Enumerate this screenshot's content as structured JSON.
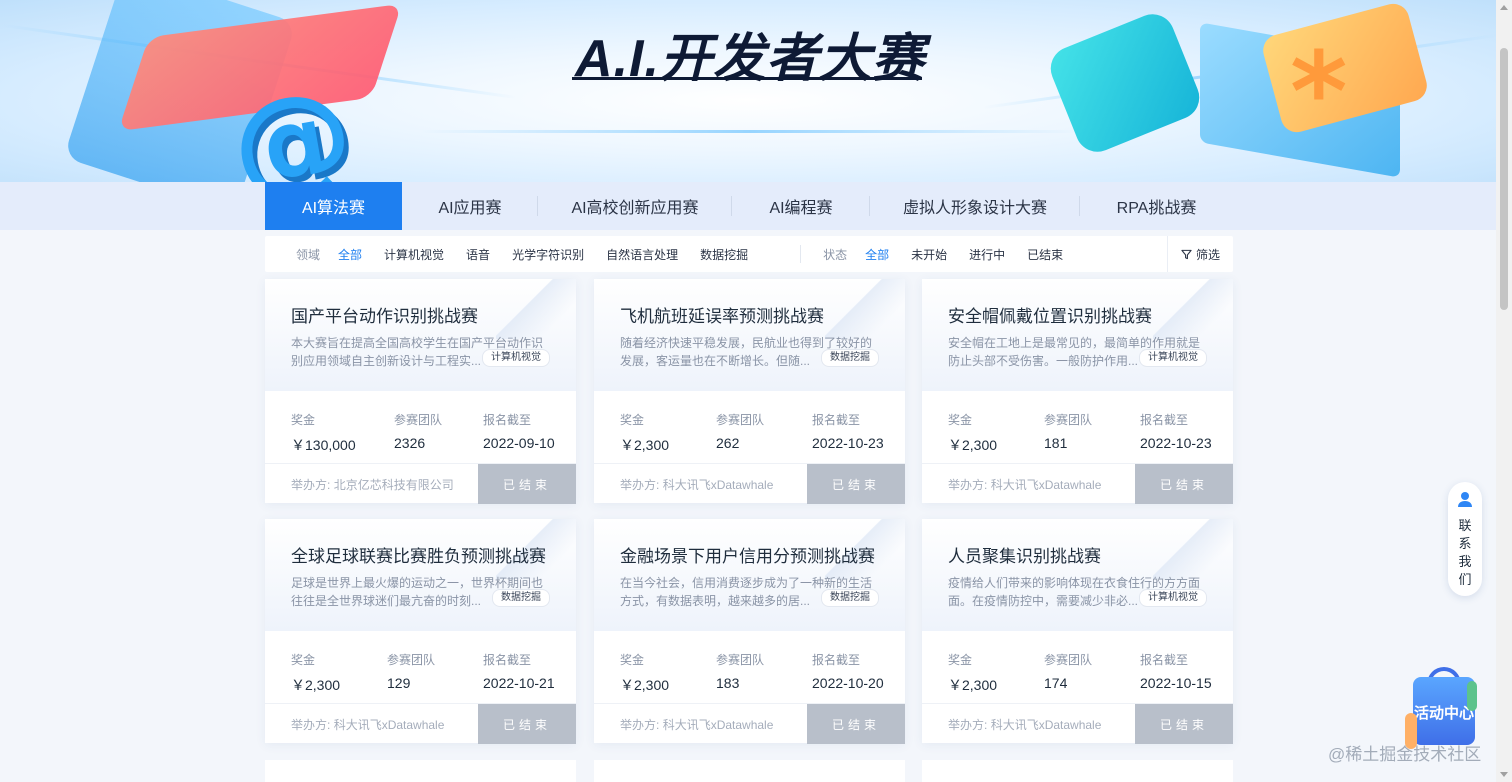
{
  "banner": {
    "logo": "A.I.开发者大赛"
  },
  "tabs": [
    {
      "label": "AI算法赛",
      "active": true
    },
    {
      "label": "AI应用赛"
    },
    {
      "label": "AI高校创新应用赛"
    },
    {
      "label": "AI编程赛"
    },
    {
      "label": "虚拟人形象设计大赛"
    },
    {
      "label": "RPA挑战赛"
    }
  ],
  "filter": {
    "domain_label": "领域",
    "domain_options": [
      "全部",
      "计算机视觉",
      "语音",
      "光学字符识别",
      "自然语言处理",
      "数据挖掘"
    ],
    "status_label": "状态",
    "status_options": [
      "全部",
      "未开始",
      "进行中",
      "已结束"
    ],
    "filter_button": "筛选"
  },
  "card_labels": {
    "prize": "奖金",
    "teams": "参赛团队",
    "deadline": "报名截至",
    "organizer_prefix": "举办方:"
  },
  "cards": [
    {
      "title": "国产平台动作识别挑战赛",
      "desc": "本大赛旨在提高全国高校学生在国产平台动作识别应用领域自主创新设计与工程实...",
      "tag": "计算机视觉",
      "prize": "￥130,000",
      "teams": "2326",
      "deadline": "2022-09-10",
      "organizer": "北京亿芯科技有限公司",
      "status": "已结束"
    },
    {
      "title": "飞机航班延误率预测挑战赛",
      "desc": "随着经济快速平稳发展，民航业也得到了较好的发展，客运量也在不断增长。但随...",
      "tag": "数据挖掘",
      "prize": "￥2,300",
      "teams": "262",
      "deadline": "2022-10-23",
      "organizer": "科大讯飞xDatawhale",
      "status": "已结束"
    },
    {
      "title": "安全帽佩戴位置识别挑战赛",
      "desc": "安全帽在工地上是最常见的，最简单的作用就是防止头部不受伤害。一般防护作用...",
      "tag": "计算机视觉",
      "prize": "￥2,300",
      "teams": "181",
      "deadline": "2022-10-23",
      "organizer": "科大讯飞xDatawhale",
      "status": "已结束"
    },
    {
      "title": "全球足球联赛比赛胜负预测挑战赛",
      "desc": "足球是世界上最火爆的运动之一，世界杯期间也往往是全世界球迷们最亢奋的时刻...",
      "tag": "数据挖掘",
      "prize": "￥2,300",
      "teams": "129",
      "deadline": "2022-10-21",
      "organizer": "科大讯飞xDatawhale",
      "status": "已结束"
    },
    {
      "title": "金融场景下用户信用分预测挑战赛",
      "desc": "在当今社会，信用消费逐步成为了一种新的生活方式，有数据表明，越来越多的居...",
      "tag": "数据挖掘",
      "prize": "￥2,300",
      "teams": "183",
      "deadline": "2022-10-20",
      "organizer": "科大讯飞xDatawhale",
      "status": "已结束"
    },
    {
      "title": "人员聚集识别挑战赛",
      "desc": "疫情给人们带来的影响体现在衣食住行的方方面面。在疫情防控中，需要减少非必...",
      "tag": "计算机视觉",
      "prize": "￥2,300",
      "teams": "174",
      "deadline": "2022-10-15",
      "organizer": "科大讯飞xDatawhale",
      "status": "已结束"
    }
  ],
  "contact": {
    "label": "联系我们"
  },
  "activity": {
    "label": "活动中心"
  },
  "watermark": "@稀土掘金技术社区"
}
